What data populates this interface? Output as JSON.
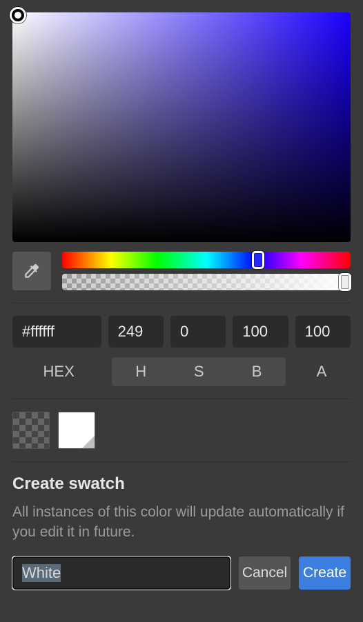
{
  "color": {
    "hex": "#ffffff",
    "h": "249",
    "s": "0",
    "b": "100",
    "a": "100",
    "hue_percent": 68,
    "alpha_percent": 98
  },
  "labels": {
    "hex": "HEX",
    "h": "H",
    "s": "S",
    "b": "B",
    "a": "A"
  },
  "swatch_dialog": {
    "title": "Create swatch",
    "description": "All instances of this color will update automatically if you edit it in future.",
    "name_value": "White",
    "cancel": "Cancel",
    "create": "Create"
  },
  "icons": {
    "eyedropper": "eyedropper-icon"
  }
}
